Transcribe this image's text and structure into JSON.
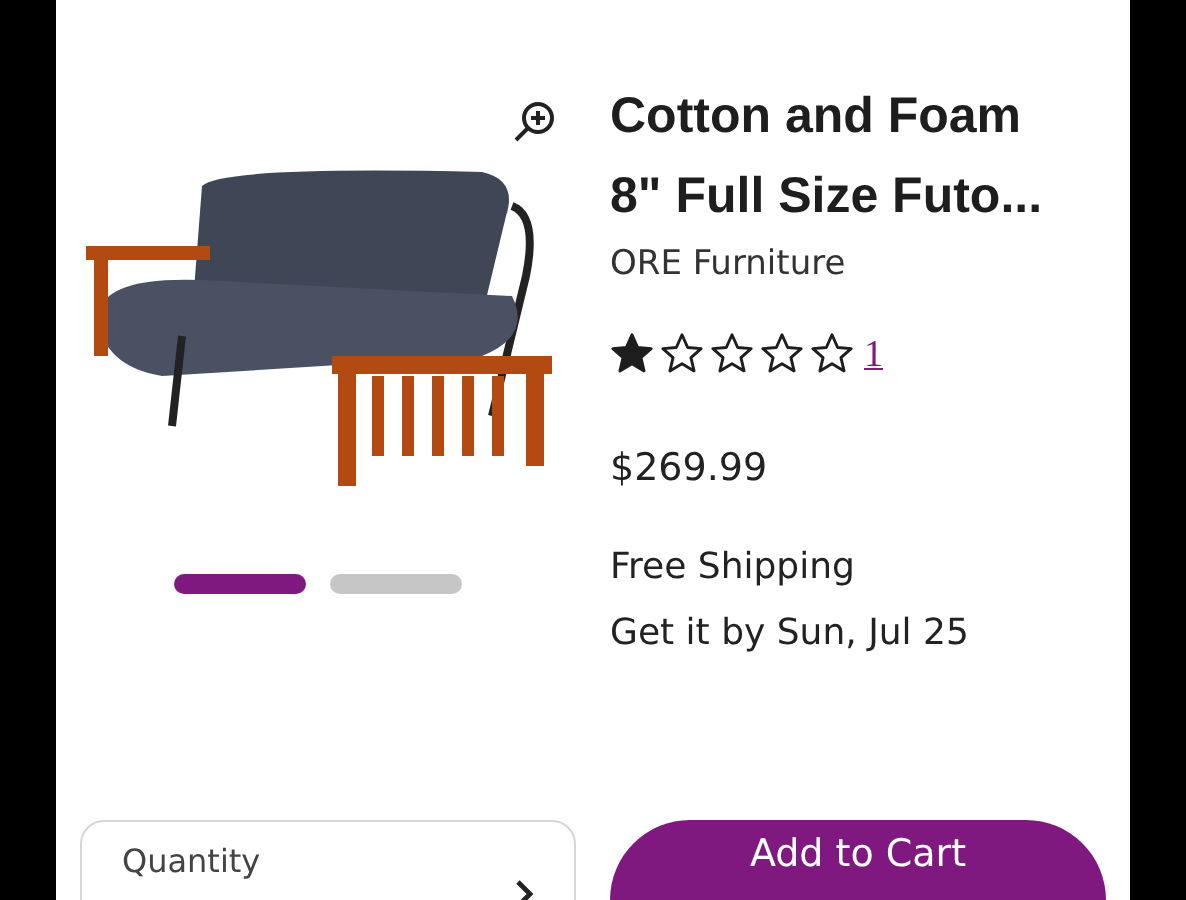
{
  "product": {
    "title_lines": [
      "Cotton and Foam",
      "8\" Full Size Futo..."
    ],
    "brand": "ORE Furniture",
    "stars": 1,
    "review_count": "1",
    "price": "$269.99",
    "shipping": "Free Shipping",
    "delivery": "Get it by Sun, Jul 25"
  },
  "gallery": {
    "indicators": [
      {
        "selected": true
      },
      {
        "selected": false
      }
    ]
  },
  "quantity": {
    "label": "Quantity"
  },
  "add_to_cart": {
    "label": "Add to Cart"
  }
}
